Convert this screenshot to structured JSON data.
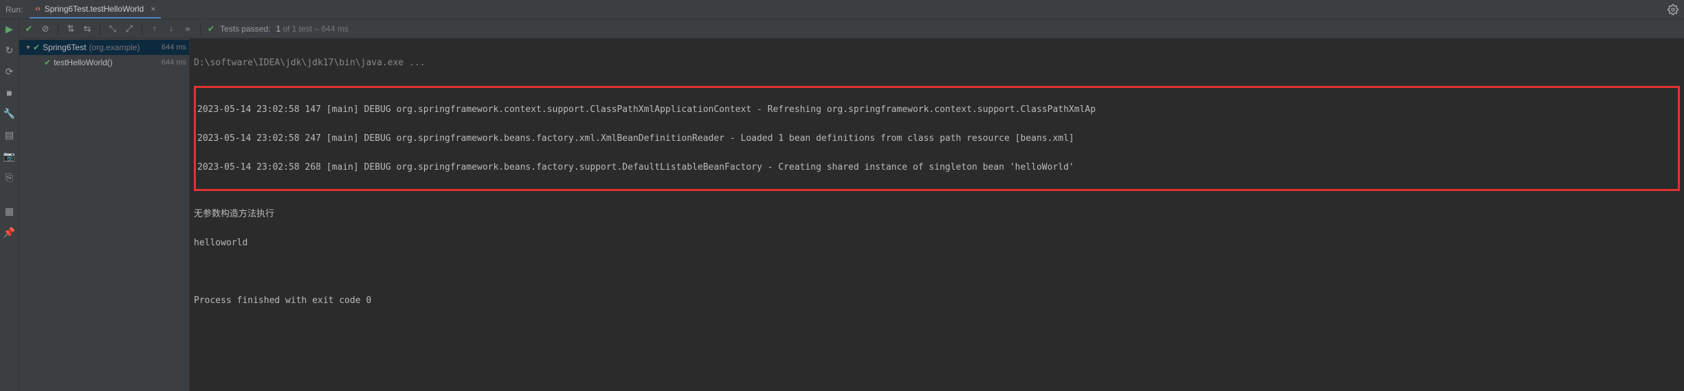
{
  "header": {
    "label": "Run:",
    "tab_icon": "‹›",
    "tab_title": "Spring6Test.testHelloWorld"
  },
  "toolbar": {
    "tests_passed_label": "Tests passed:",
    "tests_passed_count": "1",
    "tests_total": " of 1 test",
    "tests_duration": " – 644 ms"
  },
  "tree": {
    "root": {
      "name": "Spring6Test",
      "pkg": "(org.example)",
      "time": "644 ms"
    },
    "child": {
      "name": "testHelloWorld()",
      "time": "644 ms"
    }
  },
  "console": {
    "cmd": "D:\\software\\IDEA\\jdk\\jdk17\\bin\\java.exe ...",
    "log1": "2023-05-14 23:02:58 147 [main] DEBUG org.springframework.context.support.ClassPathXmlApplicationContext - Refreshing org.springframework.context.support.ClassPathXmlAp",
    "log2": "2023-05-14 23:02:58 247 [main] DEBUG org.springframework.beans.factory.xml.XmlBeanDefinitionReader - Loaded 1 bean definitions from class path resource [beans.xml]",
    "log3": "2023-05-14 23:02:58 268 [main] DEBUG org.springframework.beans.factory.support.DefaultListableBeanFactory - Creating shared instance of singleton bean 'helloWorld'",
    "out1": "无参数构造方法执行",
    "out2": "helloworld",
    "exit": "Process finished with exit code 0"
  }
}
